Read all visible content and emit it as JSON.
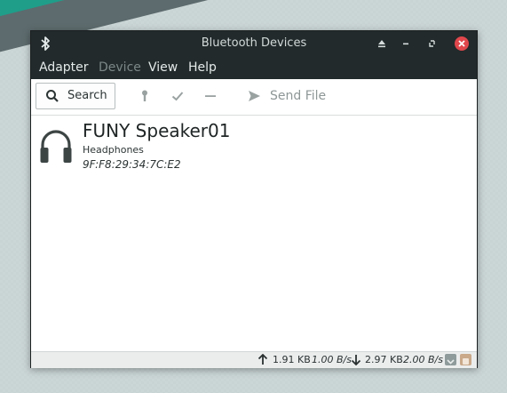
{
  "window": {
    "title": "Bluetooth Devices"
  },
  "menu": {
    "adapter": "Adapter",
    "device": "Device",
    "view": "View",
    "help": "Help"
  },
  "toolbar": {
    "search_label": "Search",
    "send_file_label": "Send File"
  },
  "device": {
    "name": "FUNY Speaker01",
    "type": "Headphones",
    "address": "9F:F8:29:34:7C:E2",
    "icon": "headphones-icon"
  },
  "status": {
    "uploaded": "1.91 KB",
    "upload_rate": "1.00 B/s",
    "downloaded": "2.97 KB",
    "download_rate": "2.00 B/s"
  },
  "colors": {
    "titlebar": "#222a2b",
    "close": "#e0474c",
    "wallpaper_accent": "#1f9e8a"
  }
}
